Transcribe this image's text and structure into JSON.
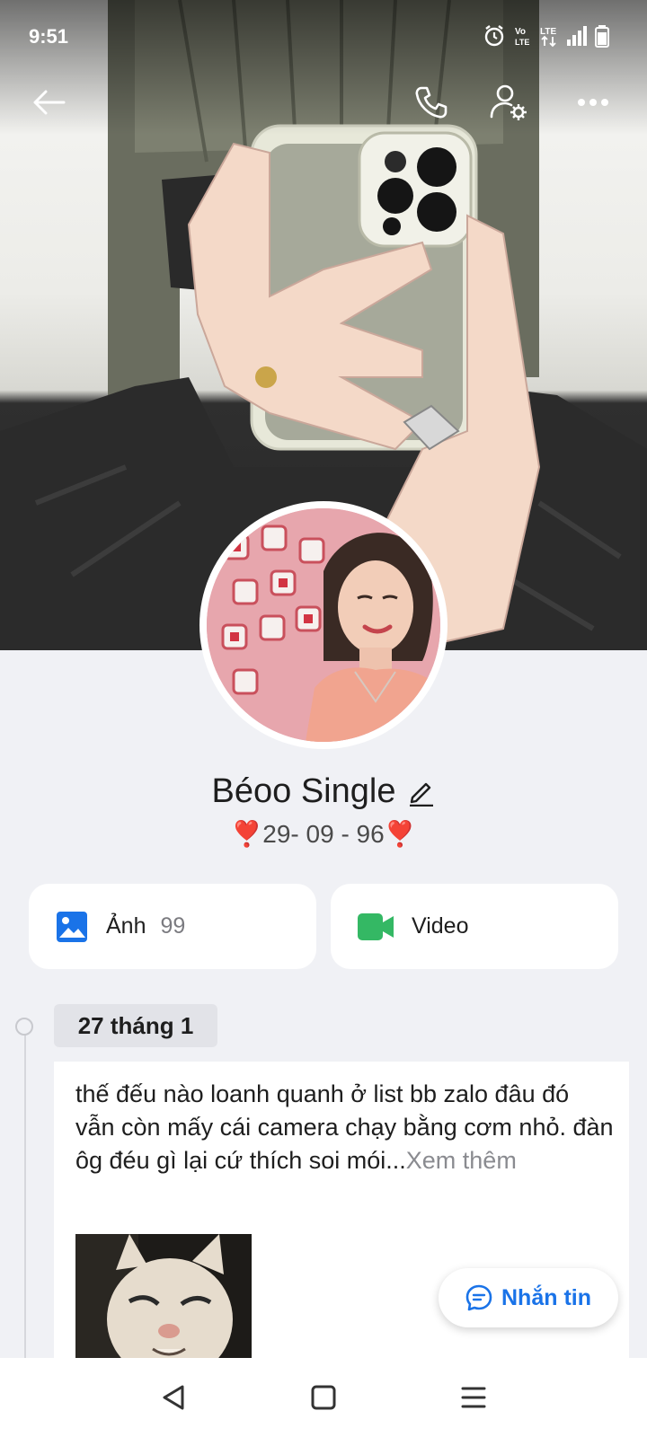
{
  "status_bar": {
    "time": "9:51",
    "icons": [
      "alarm-icon",
      "volte-icon",
      "lte-icon",
      "signal-icon",
      "battery-icon"
    ]
  },
  "header": {
    "buttons": [
      "back-arrow-icon",
      "phone-call-icon",
      "user-settings-icon",
      "more-horizontal-icon"
    ]
  },
  "profile": {
    "name": "Béoo Single",
    "bio": "❣️29- 09 - 96❣️"
  },
  "media_cards": [
    {
      "label": "Ảnh",
      "count": "99",
      "icon": "photo-icon",
      "color": "#1a73e8"
    },
    {
      "label": "Video",
      "count": "",
      "icon": "video-camera-icon",
      "color": "#34b864"
    }
  ],
  "timeline": {
    "date": "27 tháng 1",
    "post": {
      "text": "thế đếu nào loanh quanh ở list bb zalo đâu đó vẫn còn mấy cái camera chạy bằng cơm nhỏ. đàn ôg đéu gì lại cứ thích soi mói...",
      "see_more": "Xem thêm"
    }
  },
  "message_button": {
    "label": "Nhắn tin",
    "icon": "chat-bubble-icon"
  },
  "nav_bar": {
    "buttons": [
      "back-triangle-icon",
      "home-square-icon",
      "menu-lines-icon"
    ]
  },
  "colors": {
    "accent": "#1a73e8",
    "background": "#f0f1f5",
    "video_green": "#34b864"
  }
}
